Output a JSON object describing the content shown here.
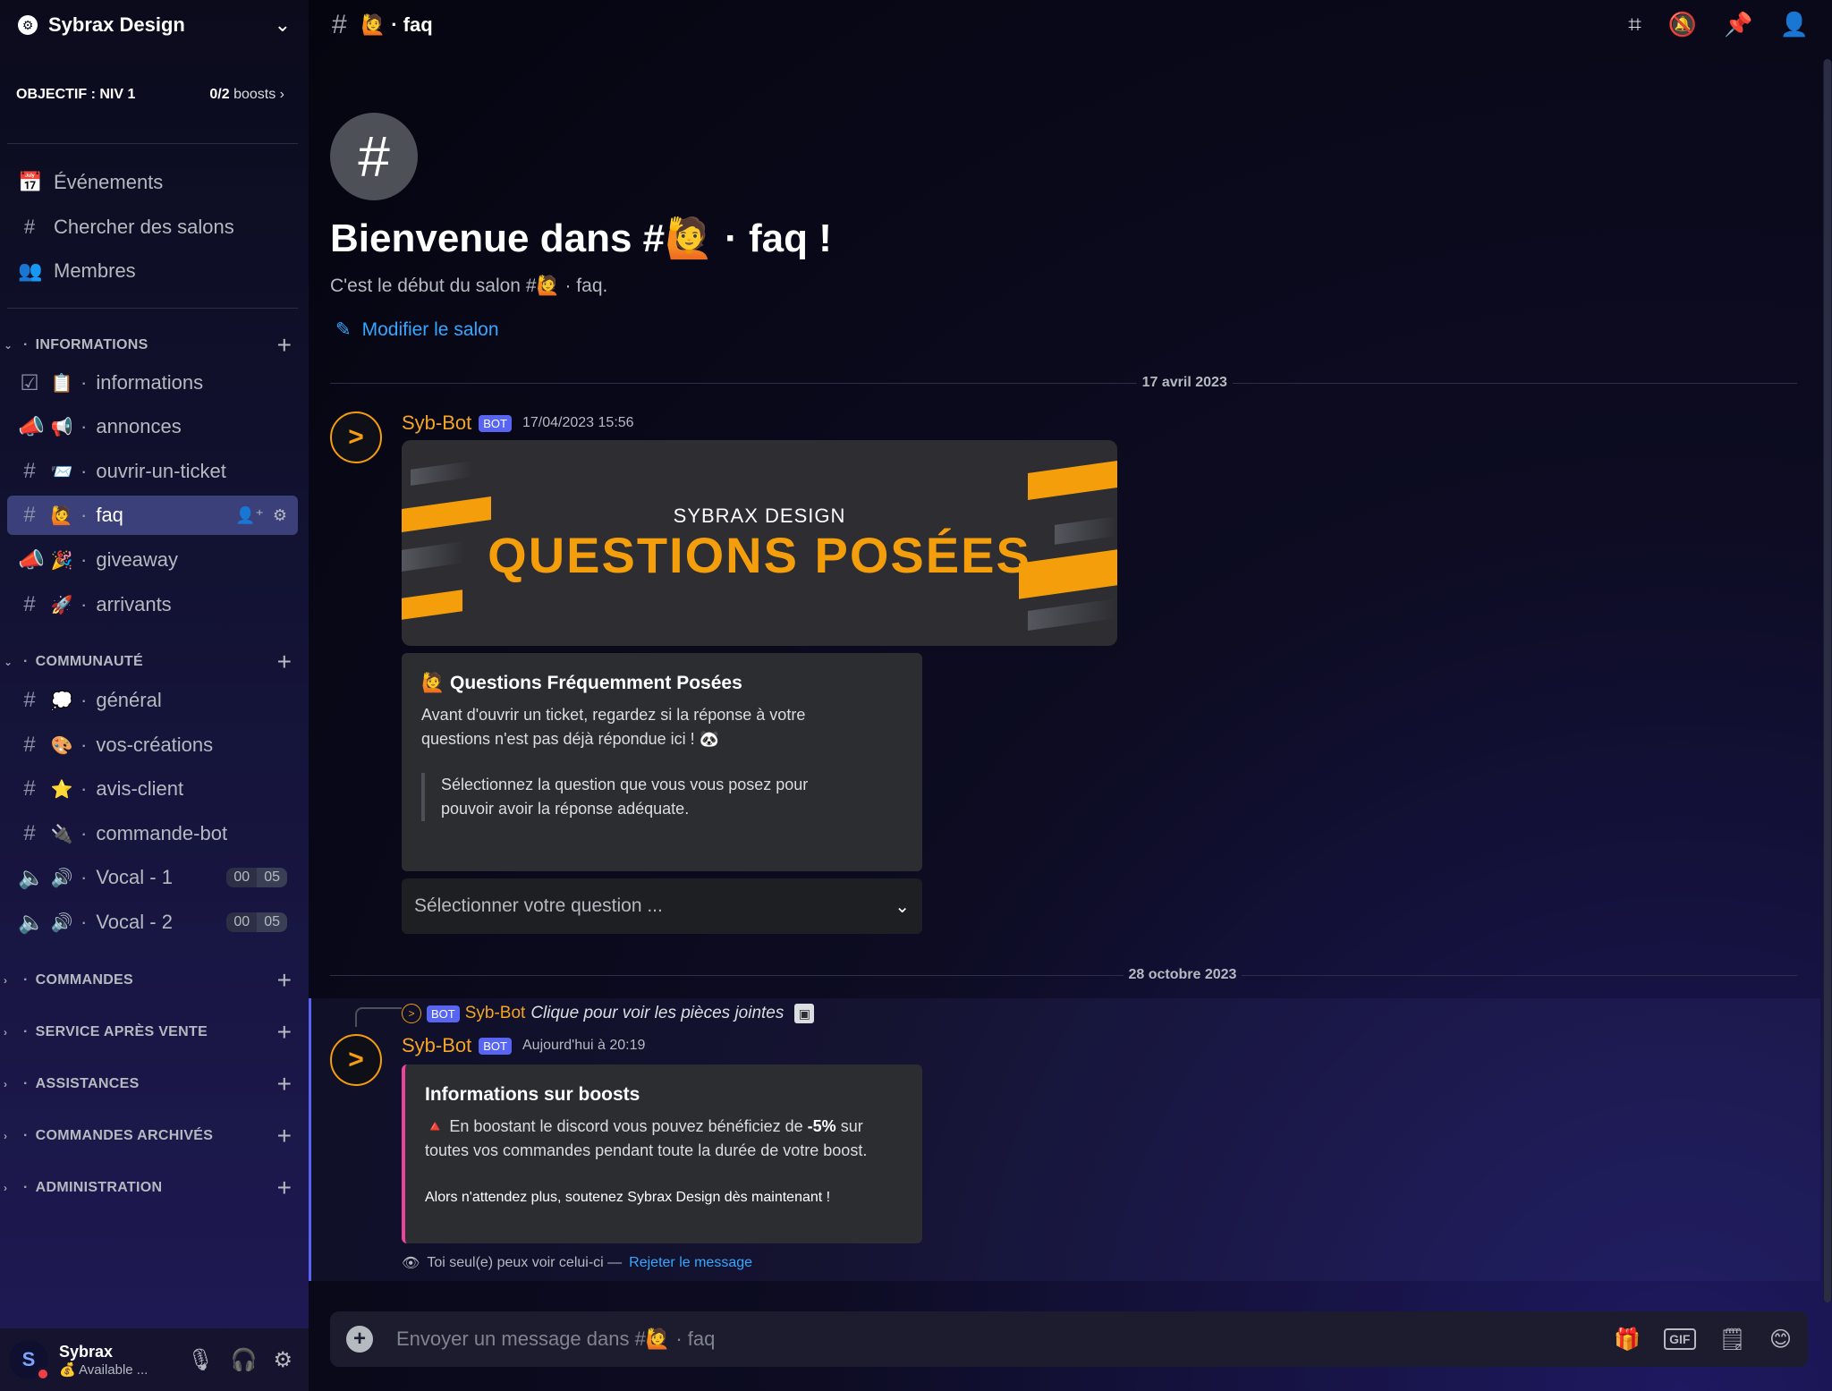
{
  "server": {
    "name": "Sybrax Design",
    "icon": "server-gear-icon"
  },
  "boost_goal": {
    "label": "OBJECTIF : NIV 1",
    "count": "0/2",
    "unit": "boosts"
  },
  "nav": [
    {
      "label": "Événements",
      "icon": "calendar-icon"
    },
    {
      "label": "Chercher des salons",
      "icon": "channel-search-icon"
    },
    {
      "label": "Membres",
      "icon": "members-icon"
    }
  ],
  "categories": {
    "informations": {
      "label": "INFORMATIONS",
      "channels": [
        {
          "name": "informations",
          "emoji": "📋",
          "type": "rules"
        },
        {
          "name": "annonces",
          "emoji": "📢",
          "type": "announcement"
        },
        {
          "name": "ouvrir-un-ticket",
          "emoji": "📨",
          "type": "text"
        },
        {
          "name": "faq",
          "emoji": "🙋",
          "type": "text",
          "active": true
        },
        {
          "name": "giveaway",
          "emoji": "🎉",
          "type": "announcement"
        },
        {
          "name": "arrivants",
          "emoji": "🚀",
          "type": "text"
        }
      ]
    },
    "communaute": {
      "label": "COMMUNAUTÉ",
      "channels": [
        {
          "name": "général",
          "emoji": "💭",
          "type": "text-locked"
        },
        {
          "name": "vos-créations",
          "emoji": "🎨",
          "type": "text-locked"
        },
        {
          "name": "avis-client",
          "emoji": "⭐",
          "type": "text-locked"
        },
        {
          "name": "commande-bot",
          "emoji": "🔌",
          "type": "text-locked"
        },
        {
          "name": "Vocal - 1",
          "emoji": "🔊",
          "type": "voice",
          "count_a": "00",
          "count_b": "05"
        },
        {
          "name": "Vocal - 2",
          "emoji": "🔊",
          "type": "voice",
          "count_a": "00",
          "count_b": "05"
        }
      ]
    },
    "collapsed": [
      {
        "label": "COMMANDES"
      },
      {
        "label": "SERVICE APRÈS VENTE"
      },
      {
        "label": "ASSISTANCES"
      },
      {
        "label": "COMMANDES ARCHIVÉS"
      },
      {
        "label": "ADMINISTRATION"
      }
    ]
  },
  "user": {
    "name": "Sybrax",
    "status": "Available ...",
    "status_emoji": "💰"
  },
  "topbar": {
    "channel": "🙋 · faq"
  },
  "welcome": {
    "title": "Bienvenue dans #🙋 · faq !",
    "subtitle": "C'est le début du salon #🙋 · faq.",
    "edit_link": "Modifier le salon"
  },
  "dates": [
    "17 avril 2023",
    "28 octobre 2023"
  ],
  "message1": {
    "author": "Syb-Bot",
    "tag": "BOT",
    "time": "17/04/2023 15:56",
    "banner": {
      "subtitle": "SYBRAX DESIGN",
      "title": "QUESTIONS POSÉES"
    },
    "embed": {
      "title": "🙋 Questions Fréquemment Posées",
      "desc_line1": "Avant d'ouvrir un ticket, regardez si la réponse à votre",
      "desc_line2": "questions n'est pas déjà répondue ici ! 🐼",
      "quote_line1": "Sélectionnez la question que vous vous posez pour",
      "quote_line2": "pouvoir avoir la réponse adéquate."
    },
    "select": {
      "placeholder": "Sélectionner votre question ..."
    }
  },
  "message2": {
    "reply": {
      "tag": "BOT",
      "author": "Syb-Bot",
      "text": "Clique pour voir les pièces jointes"
    },
    "author": "Syb-Bot",
    "tag": "BOT",
    "time": "Aujourd'hui à 20:19",
    "embed": {
      "title": "Informations sur boosts",
      "line1_pre": "🔺 En boostant le discord vous pouvez bénéficiez de ",
      "line1_bold": "-5%",
      "line1_post": " sur",
      "line2": "toutes vos commandes pendant toute la durée de votre boost.",
      "footer": "Alors n'attendez plus, soutenez Sybrax Design dès maintenant !"
    },
    "ephemeral": {
      "note": "Toi seul(e) peux voir celui-ci — ",
      "dismiss": "Rejeter le message"
    }
  },
  "composer": {
    "placeholder": "Envoyer un message dans #🙋 · faq",
    "gif_label": "GIF"
  },
  "colors": {
    "accent": "#5865f2",
    "bot_orange": "#f5a524",
    "link": "#35a7ff",
    "boost_pink": "#eb459e"
  }
}
